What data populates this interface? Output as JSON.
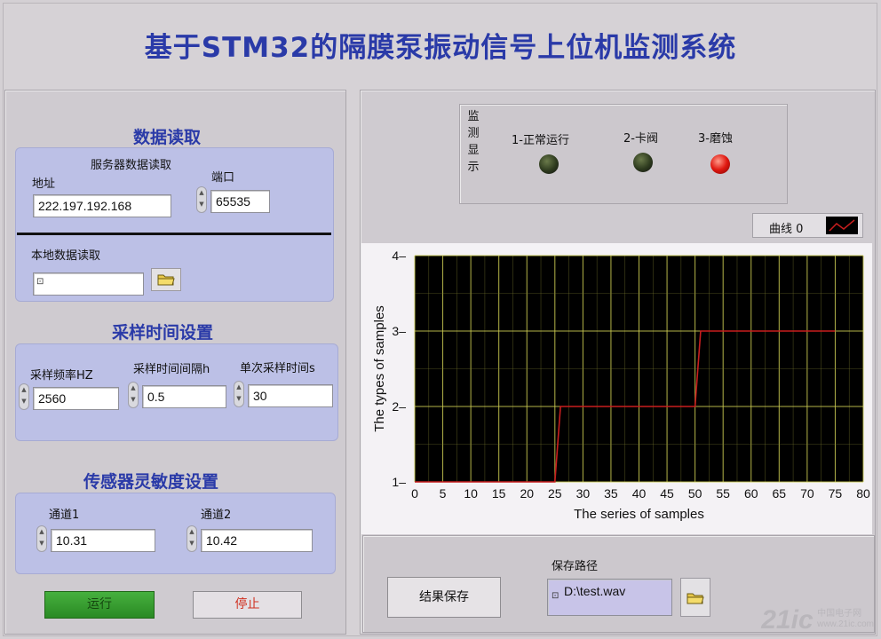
{
  "title": "基于STM32的隔膜泵振动信号上位机监测系统",
  "left": {
    "data_read": {
      "title": "数据读取",
      "server_caption": "服务器数据读取",
      "address_label": "地址",
      "address_value": "222.197.192.168",
      "port_label": "端口",
      "port_value": "65535",
      "local_label": "本地数据读取",
      "local_value": ""
    },
    "sampling": {
      "title": "采样时间设置",
      "freq_label": "采样频率HZ",
      "freq_value": "2560",
      "interval_label": "采样时间间隔h",
      "interval_value": "0.5",
      "single_label": "单次采样时间s",
      "single_value": "30"
    },
    "sensitivity": {
      "title": "传感器灵敏度设置",
      "ch1_label": "通道1",
      "ch1_value": "10.31",
      "ch2_label": "通道2",
      "ch2_value": "10.42"
    },
    "run_label": "运行",
    "stop_label": "停止"
  },
  "right": {
    "monitor": {
      "vertical_label": [
        "监",
        "测",
        "显",
        "示"
      ],
      "indicators": [
        {
          "label": "1-正常运行",
          "state": "off"
        },
        {
          "label": "2-卡阀",
          "state": "off"
        },
        {
          "label": "3-磨蚀",
          "state": "on"
        }
      ]
    },
    "legend_label": "曲线 0",
    "save_button": "结果保存",
    "save_path_label": "保存路径",
    "save_path_value": "D:\\test.wav"
  },
  "chart_data": {
    "type": "line",
    "xlabel": "The series of samples",
    "ylabel": "The types of samples",
    "xlim": [
      0,
      80
    ],
    "ylim": [
      1,
      4
    ],
    "x_ticks": [
      0,
      5,
      10,
      15,
      20,
      25,
      30,
      35,
      40,
      45,
      50,
      55,
      60,
      65,
      70,
      75,
      80
    ],
    "y_ticks": [
      1,
      2,
      3,
      4
    ],
    "grid": true,
    "background": "#000000",
    "grid_color": "#c8c850",
    "series": [
      {
        "name": "曲线 0",
        "color": "#c81e1e",
        "x": [
          0,
          25,
          26,
          50,
          51,
          75
        ],
        "y": [
          1,
          1,
          2,
          2,
          3,
          3
        ]
      }
    ]
  },
  "watermark": {
    "brand": "21ic",
    "sub": "中国电子网",
    "url": "www.21ic.com"
  },
  "colors": {
    "title": "#2a3aa8",
    "panel_blue": "#bcc0e6",
    "run_green": "#2f9a2a",
    "stop_red": "#d03020"
  }
}
